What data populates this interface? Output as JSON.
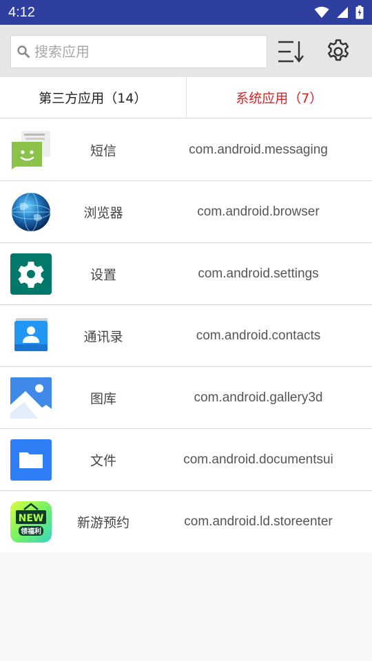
{
  "status_bar": {
    "time": "4:12",
    "icons": [
      "wifi-icon",
      "signal-icon",
      "battery-icon"
    ]
  },
  "search": {
    "placeholder": "搜索应用",
    "value": ""
  },
  "toolbar": {
    "sort_icon": "sort-icon",
    "settings_icon": "gear-icon"
  },
  "tabs": [
    {
      "label": "第三方应用（14）",
      "active": false
    },
    {
      "label": "系统应用（7）",
      "active": true
    }
  ],
  "colors": {
    "status_bar": "#2f3fa0",
    "active_tab": "#e02020"
  },
  "apps": [
    {
      "name": "短信",
      "package": "com.android.messaging",
      "icon": "messaging-icon"
    },
    {
      "name": "浏览器",
      "package": "com.android.browser",
      "icon": "browser-globe-icon"
    },
    {
      "name": "设置",
      "package": "com.android.settings",
      "icon": "settings-gear-icon"
    },
    {
      "name": "通讯录",
      "package": "com.android.contacts",
      "icon": "contacts-icon"
    },
    {
      "name": "图库",
      "package": "com.android.gallery3d",
      "icon": "gallery-icon"
    },
    {
      "name": "文件",
      "package": "com.android.documentsui",
      "icon": "folder-icon"
    },
    {
      "name": "新游预约",
      "package": "com.android.ld.storeenter",
      "icon": "new-game-icon",
      "icon_text": [
        "NEW",
        "领福利"
      ]
    }
  ]
}
